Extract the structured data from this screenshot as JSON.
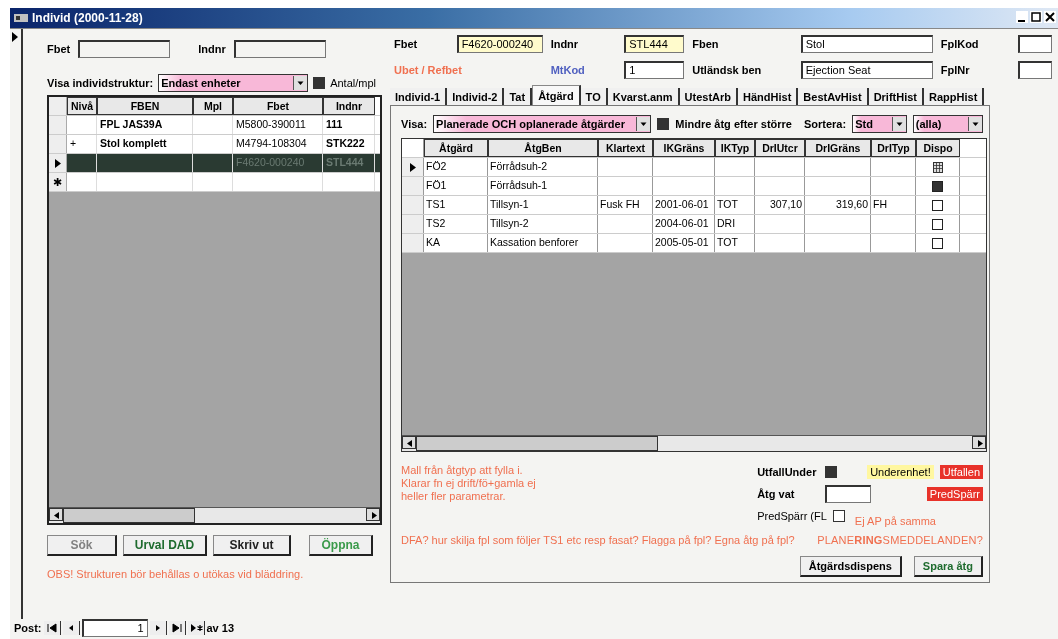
{
  "window": {
    "title": "Individ (2000-11-28)"
  },
  "search": {
    "fields": [
      {
        "label": "Fbet"
      },
      {
        "label": "Indnr"
      }
    ]
  },
  "structure": {
    "label": "Visa individstruktur:",
    "value": "Endast enheter",
    "checkbox": {
      "label": "Antal/mpl",
      "checked": true
    }
  },
  "left_table": {
    "columns": [
      "Nivå",
      "FBEN",
      "Mpl",
      "Fbet",
      "Indnr"
    ],
    "new_row_marker": "✱",
    "rows": [
      {
        "cells": [
          "",
          "FPL JAS39A",
          "",
          "M5800-390011",
          "111"
        ],
        "selected": false
      },
      {
        "cells": [
          "+",
          "Stol komplett",
          "",
          "M4794-108304",
          "STK222"
        ],
        "selected": false
      },
      {
        "cells": [
          "",
          "",
          "",
          "F4620-000240",
          "STL444"
        ],
        "selected": true
      }
    ]
  },
  "left_buttons": [
    {
      "label": "Sök",
      "color": "#808080"
    },
    {
      "label": "Urval DAD",
      "color": "#1e6b2e"
    },
    {
      "label": "Skriv ut",
      "color": "#222222"
    },
    {
      "label": "Öppna",
      "color": "#3a9a4a"
    }
  ],
  "obs_note": "OBS! Strukturen bör behållas o utökas vid bläddring.",
  "navigator": {
    "label": "Post:",
    "record": "1",
    "total": "av 13"
  },
  "header_fields": [
    {
      "label": "Fbet",
      "color": "#000000",
      "kind": "field",
      "value": "F4620-000240",
      "highlight": true
    },
    {
      "label": "Indnr",
      "color": "#000000",
      "kind": "field",
      "value": "STL444",
      "highlight": true
    },
    {
      "label": "Fben",
      "color": "#000000",
      "kind": "field",
      "value": "Stol",
      "highlight": false
    },
    {
      "label": "FplKod",
      "color": "#000000",
      "kind": "field",
      "highlight": false
    },
    {
      "label": "Ubet / Refbet",
      "color": "#f07050",
      "kind": "label"
    },
    {
      "label": "MtKod",
      "color": "#5060c0",
      "kind": "field",
      "value": "1",
      "highlight": false
    },
    {
      "label": "Utländsk ben",
      "color": "#000000",
      "kind": "field",
      "value": "Ejection Seat",
      "highlight": false
    },
    {
      "label": "FplNr",
      "color": "#000000",
      "kind": "field",
      "highlight": false
    }
  ],
  "tabs": [
    {
      "label": "Individ-1",
      "selected": false
    },
    {
      "label": "Individ-2",
      "selected": false
    },
    {
      "label": "Tat",
      "selected": false
    },
    {
      "label": "Åtgärd",
      "selected": true
    },
    {
      "label": "TO",
      "selected": false
    },
    {
      "label": "Kvarst.anm",
      "selected": false
    },
    {
      "label": "UtestArb",
      "selected": false
    },
    {
      "label": "HändHist",
      "selected": false
    },
    {
      "label": "BestAvHist",
      "selected": false
    },
    {
      "label": "DriftHist",
      "selected": false
    },
    {
      "label": "RappHist",
      "selected": false
    }
  ],
  "filter": {
    "label": "Visa:",
    "value": "Planerade OCH oplanerade åtgärder",
    "checkbox": {
      "label": "Mindre åtg efter större",
      "checked": true
    },
    "sort_label": "Sortera:",
    "sort_value": "Std",
    "sort_value_2": "(alla)"
  },
  "action_table": {
    "columns": [
      "Åtgärd",
      "ÅtgBen",
      "Klartext",
      "IKGräns",
      "IKTyp",
      "DrIUtcr",
      "DrIGräns",
      "DrITyp",
      "Dispo"
    ],
    "rows": [
      {
        "cells": [
          "FÖ2",
          "Förrådsuh-2",
          "",
          "",
          "",
          "",
          "",
          "",
          ""
        ],
        "kind": "grid",
        "selected": true
      },
      {
        "cells": [
          "FÖ1",
          "Förrådsuh-1",
          "",
          "",
          "",
          "",
          "",
          "",
          ""
        ],
        "kind": "filled",
        "selected": false
      },
      {
        "cells": [
          "TS1",
          "Tillsyn-1",
          "Fusk FH",
          "2001-06-01",
          "TOT",
          "307,10",
          "319,60",
          "FH",
          ""
        ],
        "kind": "empty",
        "selected": false
      },
      {
        "cells": [
          "TS2",
          "Tillsyn-2",
          "",
          "2004-06-01",
          "DRI",
          "",
          "",
          "",
          ""
        ],
        "kind": "empty",
        "selected": false
      },
      {
        "cells": [
          "KA",
          "Kassation benforer",
          "",
          "2005-05-01",
          "TOT",
          "",
          "",
          "",
          ""
        ],
        "kind": "empty",
        "selected": false
      }
    ]
  },
  "note_lines": [
    "Mall från åtgtyp att fylla i.",
    "Klarar fn ej drift/fö+gamla ej",
    "heller fler parametrar."
  ],
  "utfall": {
    "label": "UtfallUnder",
    "checked": true,
    "badges": [
      {
        "label": "Underenhet!",
        "kind": "warning"
      },
      {
        "label": "Utfallen",
        "kind": "alert"
      }
    ]
  },
  "atg_vat": {
    "label": "Åtg vat",
    "badge": "PredSpärr"
  },
  "predsparr": {
    "label": "PredSpärr (FL",
    "checked": false,
    "note": "Ej AP på samma"
  },
  "question": "DFA? hur skilja fpl som följer TS1 etc resp fasat? Flagga på fpl? Egna åtg på fpl?",
  "planning": "PLANE**RING**SMEDDELANDEN?",
  "action_buttons": [
    "Åtgärdsdispens",
    "Spara åtg"
  ]
}
